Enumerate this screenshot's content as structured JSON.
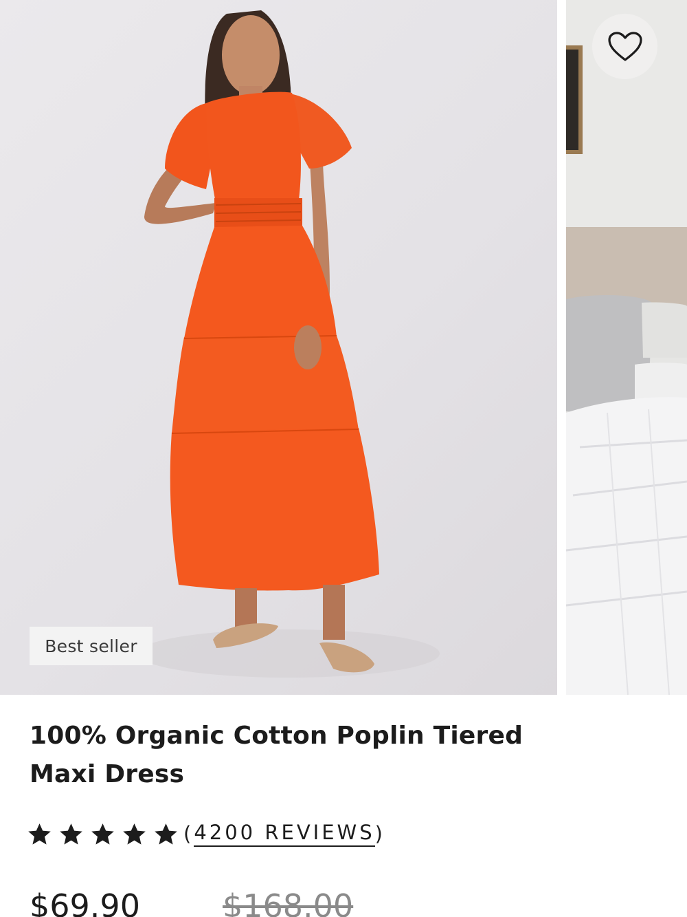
{
  "gallery": {
    "badge": "Best seller",
    "favorite_icon": "heart-outline-icon"
  },
  "product": {
    "title": "100% Organic Cotton Poplin Tiered Maxi Dress",
    "rating": {
      "stars": 5,
      "max": 5,
      "open_paren": "(",
      "reviews_label": "4200 REVIEWS",
      "close_paren": ")"
    },
    "price": "$69.90",
    "original_price": "$168.00"
  },
  "colors": {
    "dress": "#f2551c",
    "text": "#1c1c1c",
    "badge_bg": "#f3f3f3"
  }
}
